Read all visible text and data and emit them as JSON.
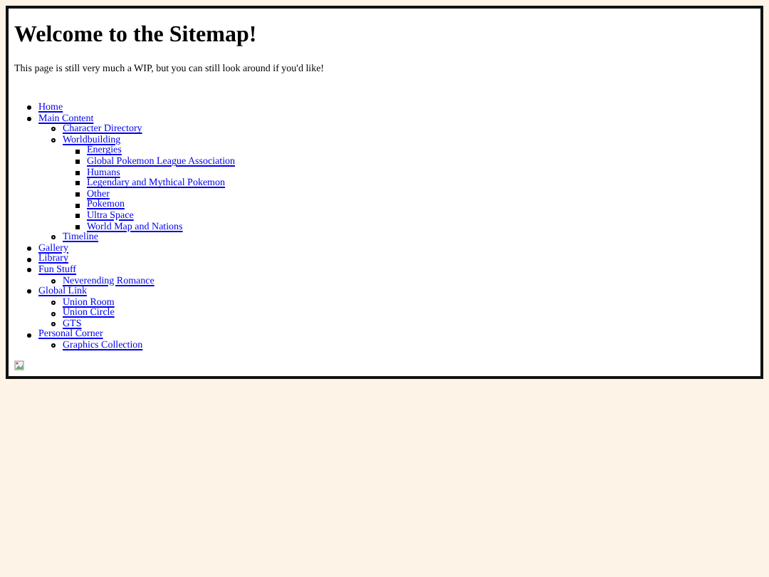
{
  "heading": "Welcome to the Sitemap!",
  "intro": "This page is still very much a WIP, but you can still look around if you'd like!",
  "sitemap": [
    {
      "label": "Home"
    },
    {
      "label": "Main Content",
      "children": [
        {
          "label": "Character Directory"
        },
        {
          "label": "Worldbuilding",
          "children": [
            {
              "label": "Energies"
            },
            {
              "label": "Global Pokemon League Association"
            },
            {
              "label": "Humans"
            },
            {
              "label": "Legendary and Mythical Pokemon"
            },
            {
              "label": "Other"
            },
            {
              "label": "Pokemon"
            },
            {
              "label": "Ultra Space"
            },
            {
              "label": "World Map and Nations"
            }
          ]
        },
        {
          "label": "Timeline"
        }
      ]
    },
    {
      "label": "Gallery"
    },
    {
      "label": "Library"
    },
    {
      "label": "Fun Stuff",
      "children": [
        {
          "label": "Neverending Romance"
        }
      ]
    },
    {
      "label": "Global Link",
      "children": [
        {
          "label": "Union Room"
        },
        {
          "label": "Union Circle"
        },
        {
          "label": "GTS"
        }
      ]
    },
    {
      "label": "Personal Corner",
      "children": [
        {
          "label": "Graphics Collection"
        }
      ]
    }
  ]
}
